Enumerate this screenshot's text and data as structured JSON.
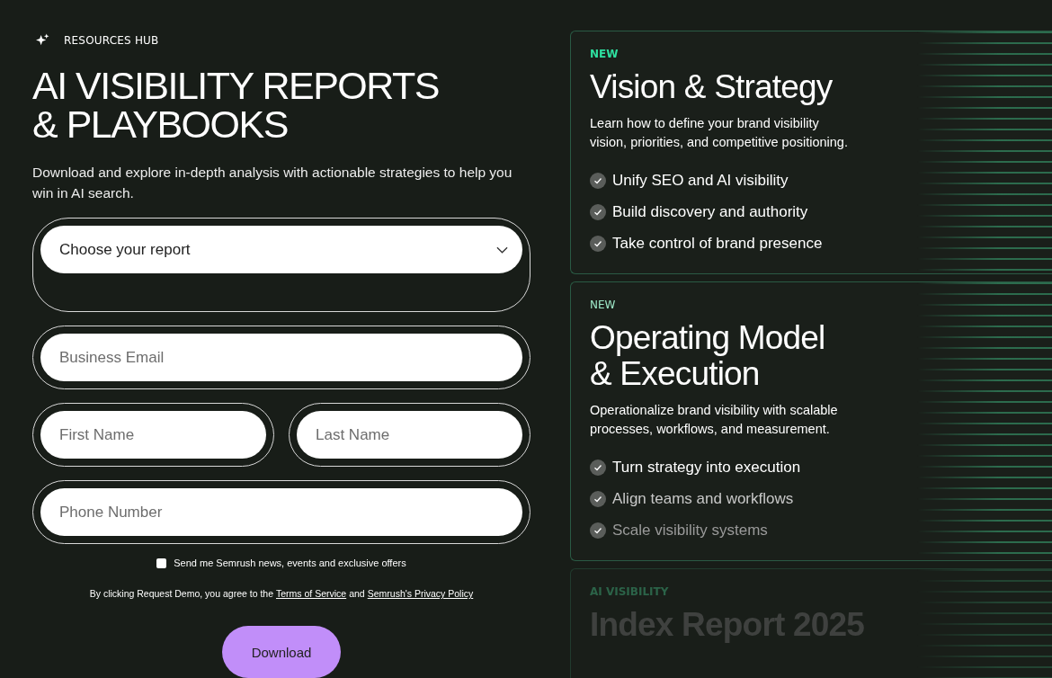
{
  "eyebrow": "RESOURCES HUB",
  "title": [
    "AI VISIBILITY REPORTS",
    "& PLAYBOOKS"
  ],
  "intro": "Download and explore in-depth analysis with actionable strategies to help you win in AI search.",
  "form": {
    "report_select": {
      "value": "Choose your report"
    },
    "fields": [
      {
        "placeholder": "Business Email",
        "kind": "full"
      },
      {
        "placeholder": "First Name",
        "kind": "half"
      },
      {
        "placeholder": "Last Name",
        "kind": "half"
      },
      {
        "placeholder": "Phone Number",
        "kind": "full"
      }
    ],
    "newsletter": {
      "label": "Send me Semrush news, events and exclusive offers",
      "checked": false
    },
    "consent": {
      "text": "By clicking Request Demo, you agree to the",
      "link_1": "Terms of Service",
      "joiner": "and",
      "link_2": "Semrush's Privacy Policy"
    },
    "submit": "Download"
  },
  "cards": [
    {
      "tag": "NEW",
      "title": [
        "Vision & Strategy"
      ],
      "description": [
        "Learn how to define your brand visibility",
        "vision, priorities, and competitive positioning."
      ],
      "points": [
        "Unify SEO and AI visibility",
        "Build discovery and authority",
        "Take control of brand presence"
      ]
    },
    {
      "tag": "NEW",
      "title": [
        "Operating Model",
        "& Execution"
      ],
      "description": [
        "Operationalize brand visibility with scalable",
        "processes, workflows, and measurement."
      ],
      "points": [
        "Turn strategy into execution",
        "Align teams and workflows",
        "Scale visibility systems"
      ]
    },
    {
      "tag": "AI VISIBILITY",
      "title": [
        "Index Report 2025"
      ]
    }
  ]
}
